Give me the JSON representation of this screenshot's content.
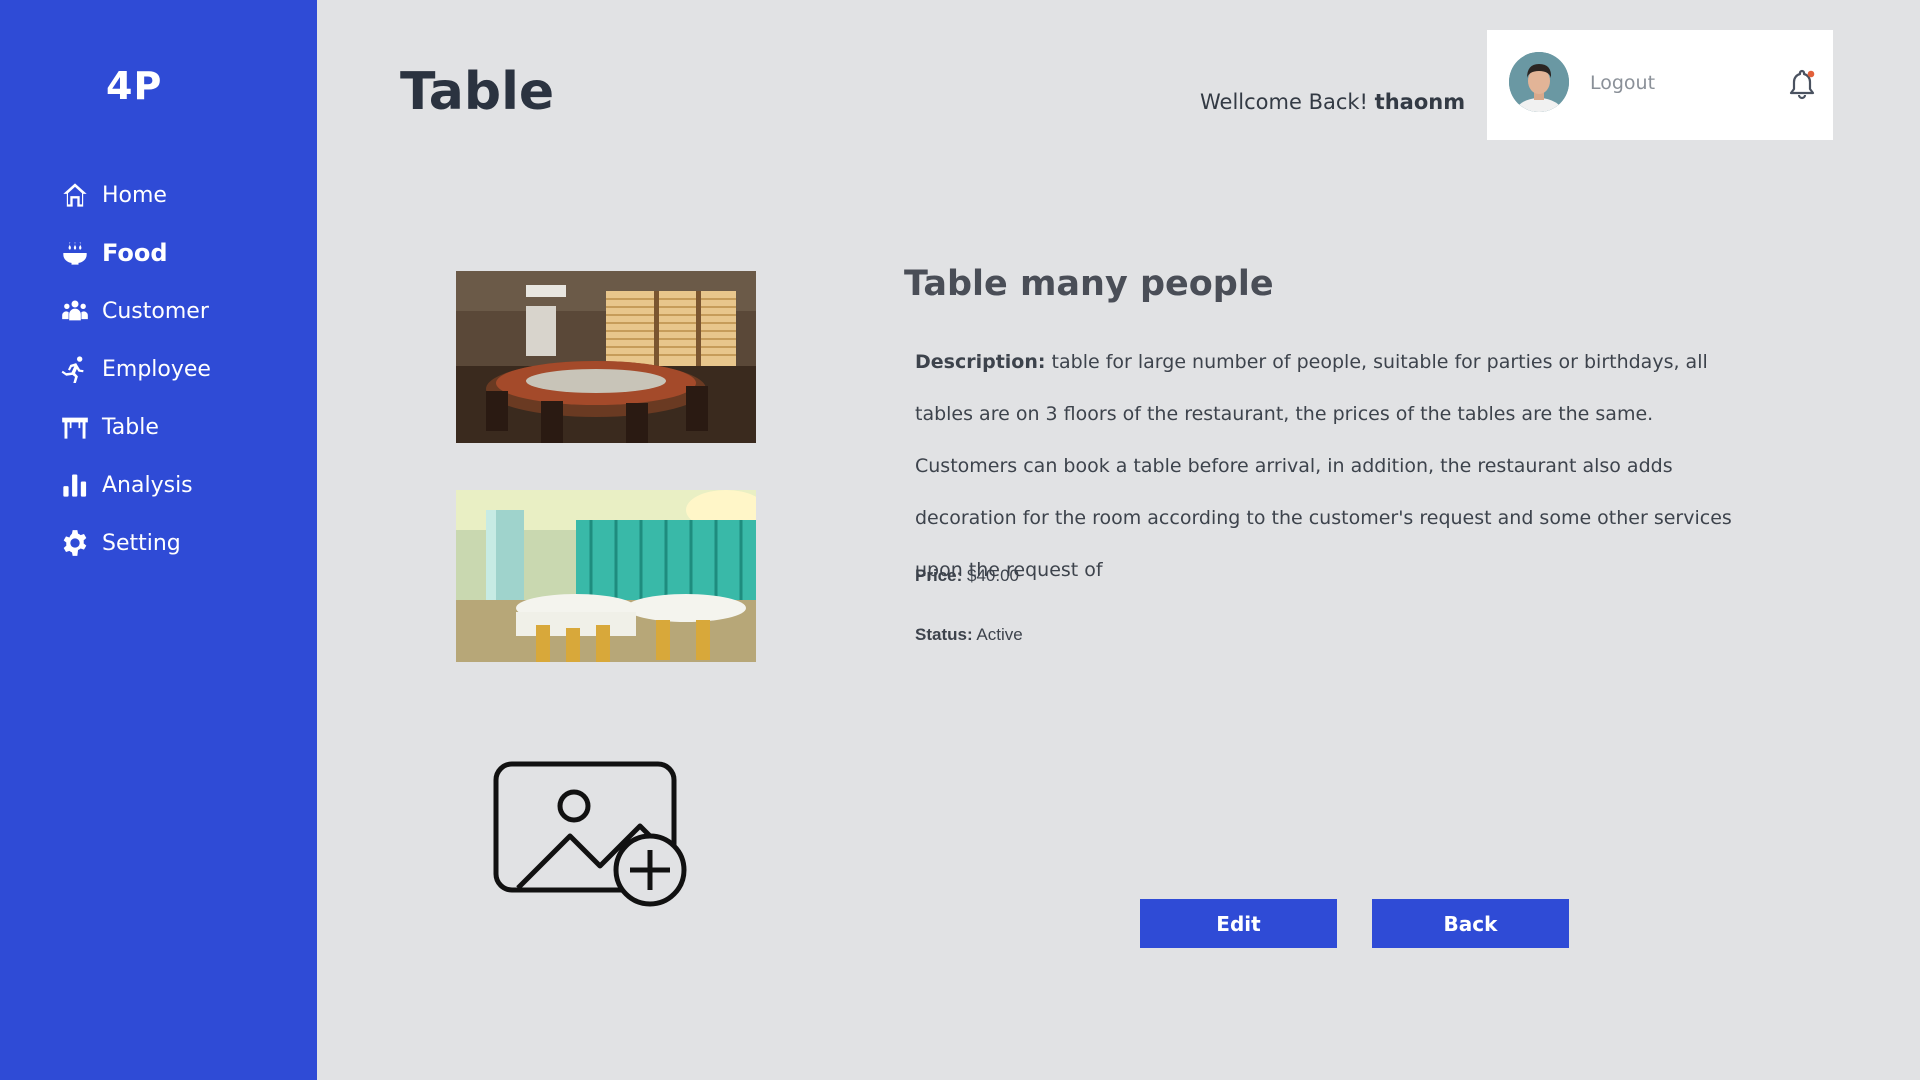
{
  "app": {
    "logo": "4P"
  },
  "sidebar": {
    "items": [
      {
        "label": "Home",
        "icon": "home-icon",
        "active": false
      },
      {
        "label": "Food",
        "icon": "food-bowl-icon",
        "active": true
      },
      {
        "label": "Customer",
        "icon": "users-icon",
        "active": false
      },
      {
        "label": "Employee",
        "icon": "running-person-icon",
        "active": false
      },
      {
        "label": "Table",
        "icon": "table-icon",
        "active": false
      },
      {
        "label": "Analysis",
        "icon": "bar-chart-icon",
        "active": false
      },
      {
        "label": "Setting",
        "icon": "gear-icon",
        "active": false
      }
    ]
  },
  "header": {
    "title": "Table",
    "welcome_prefix": "Wellcome Back!",
    "username": "thaonm",
    "logout_label": "Logout"
  },
  "detail": {
    "title": "Table many people",
    "description_label": "Description:",
    "description_text": "table for large number of people, suitable for parties or birthdays, all tables are on 3 floors  of the restaurant, the prices of the tables are the same. Customers can book a table before  arrival, in addition, the   restaurant   also  adds   decoration   for  the  room according   to  the  customer's  request and some  other services upon the request of",
    "price_label": "Price:",
    "price_value": "$40.00",
    "status_label": "Status:",
    "status_value": "Active"
  },
  "actions": {
    "edit_label": "Edit",
    "back_label": "Back"
  },
  "colors": {
    "primary": "#2f4bd6",
    "background": "#e1e2e4",
    "notification_dot": "#e2603a"
  }
}
